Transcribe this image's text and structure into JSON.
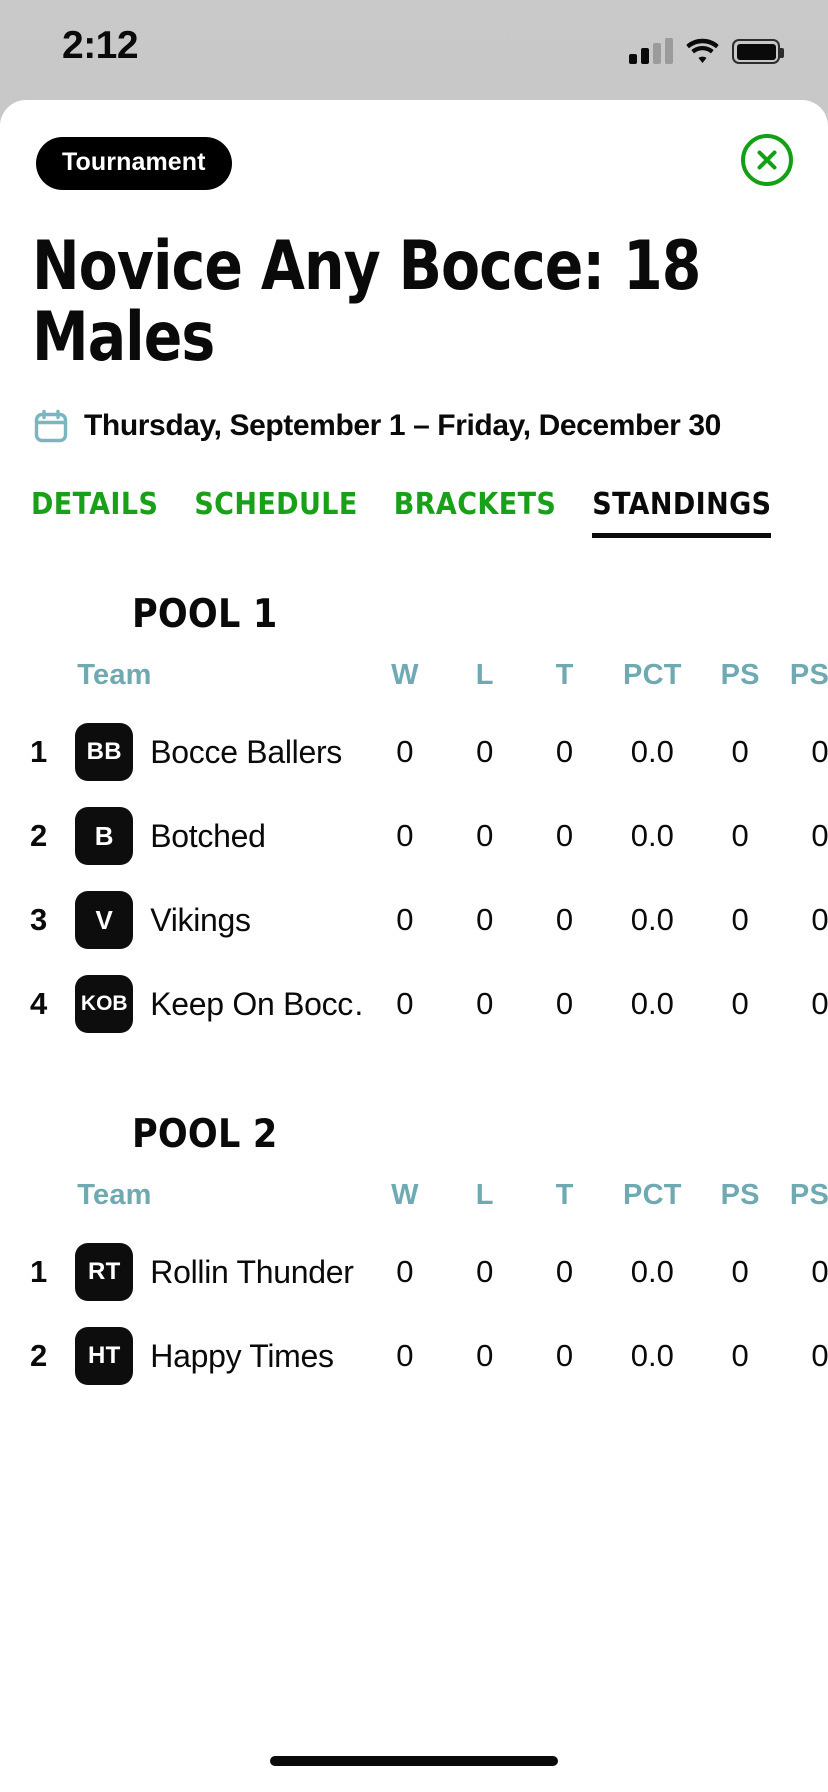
{
  "status_bar": {
    "time": "2:12",
    "signal_icon": "cellular-signal-icon",
    "wifi_icon": "wifi-icon",
    "battery_icon": "battery-full-icon"
  },
  "header": {
    "badge_label": "Tournament",
    "close_icon": "close-circle-icon",
    "accent_green": "#14a014"
  },
  "title": "Novice Any Bocce: 18 Males",
  "date_range": {
    "icon": "calendar-icon",
    "text": "Thursday, September 1 – Friday, December 30",
    "icon_color": "#7bb6c0"
  },
  "tabs": [
    {
      "label": "DETAILS",
      "active": false
    },
    {
      "label": "SCHEDULE",
      "active": false
    },
    {
      "label": "BRACKETS",
      "active": false
    },
    {
      "label": "STANDINGS",
      "active": true
    }
  ],
  "standings": {
    "columns": [
      "Team",
      "W",
      "L",
      "T",
      "PCT",
      "PS",
      "PSA"
    ],
    "header_color": "#6fa9b2",
    "pools": [
      {
        "name": "POOL 1",
        "rows": [
          {
            "rank": "1",
            "initials": "BB",
            "team": "Bocce Ballers",
            "W": "0",
            "L": "0",
            "T": "0",
            "PCT": "0.0",
            "PS": "0",
            "PSA": "0"
          },
          {
            "rank": "2",
            "initials": "B",
            "team": "Botched",
            "W": "0",
            "L": "0",
            "T": "0",
            "PCT": "0.0",
            "PS": "0",
            "PSA": "0"
          },
          {
            "rank": "3",
            "initials": "V",
            "team": "Vikings",
            "W": "0",
            "L": "0",
            "T": "0",
            "PCT": "0.0",
            "PS": "0",
            "PSA": "0"
          },
          {
            "rank": "4",
            "initials": "KOB",
            "team": "Keep On Bocc…",
            "W": "0",
            "L": "0",
            "T": "0",
            "PCT": "0.0",
            "PS": "0",
            "PSA": "0"
          }
        ]
      },
      {
        "name": "POOL 2",
        "rows": [
          {
            "rank": "1",
            "initials": "RT",
            "team": "Rollin Thunder",
            "W": "0",
            "L": "0",
            "T": "0",
            "PCT": "0.0",
            "PS": "0",
            "PSA": "0"
          },
          {
            "rank": "2",
            "initials": "HT",
            "team": "Happy Times",
            "W": "0",
            "L": "0",
            "T": "0",
            "PCT": "0.0",
            "PS": "0",
            "PSA": "0"
          }
        ]
      }
    ]
  },
  "home_indicator": "home-indicator"
}
